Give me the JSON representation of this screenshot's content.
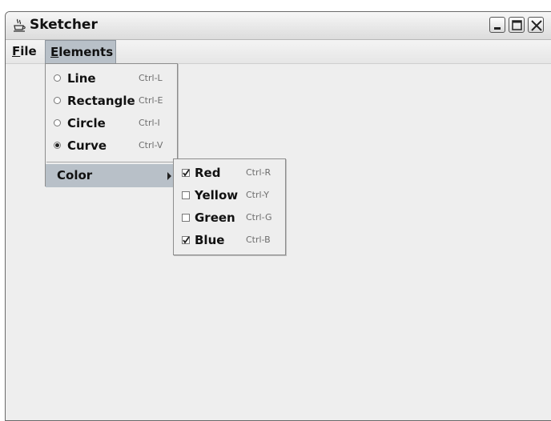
{
  "window": {
    "title": "Sketcher",
    "app_icon": "java-coffee-cup-icon",
    "controls": [
      "minimize-icon",
      "maximize-icon",
      "close-icon"
    ]
  },
  "menubar": {
    "file": {
      "mnemonic": "F",
      "rest": "ile"
    },
    "elements": {
      "mnemonic": "E",
      "rest": "lements"
    }
  },
  "elements_menu": {
    "items": [
      {
        "label": "Line",
        "accelerator": "Ctrl-L",
        "selected": false
      },
      {
        "label": "Rectangle",
        "accelerator": "Ctrl-E",
        "selected": false
      },
      {
        "label": "Circle",
        "accelerator": "Ctrl-I",
        "selected": false
      },
      {
        "label": "Curve",
        "accelerator": "Ctrl-V",
        "selected": true
      }
    ],
    "submenu": {
      "label": "Color"
    }
  },
  "color_menu": {
    "items": [
      {
        "label": "Red",
        "accelerator": "Ctrl-R",
        "checked": true
      },
      {
        "label": "Yellow",
        "accelerator": "Ctrl-Y",
        "checked": false
      },
      {
        "label": "Green",
        "accelerator": "Ctrl-G",
        "checked": false
      },
      {
        "label": "Blue",
        "accelerator": "Ctrl-B",
        "checked": true
      }
    ]
  },
  "colors": {
    "highlight": "#b8c0c8",
    "background": "#eeeeee"
  }
}
